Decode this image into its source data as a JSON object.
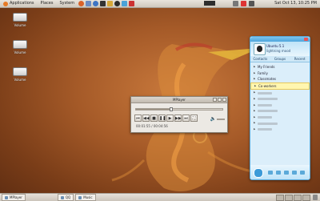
{
  "top_panel": {
    "menus": [
      "Applications",
      "Places",
      "System"
    ],
    "tray_input": "",
    "clock": "Sat Oct 13, 10:25 PM"
  },
  "desktop_icons": [
    {
      "label": "Volume"
    },
    {
      "label": "Volume"
    },
    {
      "label": "Volume"
    }
  ],
  "player": {
    "title": "MPlayer",
    "time": "00:01:55 / 00:04:56",
    "progress": 0.41
  },
  "qq": {
    "name": "Ubuntu 5.1",
    "status": "lightning mood",
    "tabs": [
      "Contacts",
      "Groups",
      "Recent"
    ],
    "groups": [
      {
        "label": "My Friends",
        "selected": false
      },
      {
        "label": "Family",
        "selected": false
      },
      {
        "label": "Classmates",
        "selected": false
      },
      {
        "label": "Co-workers",
        "selected": true
      },
      {
        "label": "",
        "selected": false
      },
      {
        "label": "",
        "selected": false
      },
      {
        "label": "",
        "selected": false
      },
      {
        "label": "",
        "selected": false
      },
      {
        "label": "",
        "selected": false
      },
      {
        "label": "",
        "selected": false
      },
      {
        "label": "",
        "selected": false
      }
    ]
  },
  "taskbar": {
    "tasks": [
      "MPlayer",
      "QQ",
      "Music"
    ]
  },
  "colors": {
    "desktop_center": "#c9793c",
    "desktop_edge": "#5e2d12",
    "qq_blue": "#4ea6dc",
    "selected_row": "#fff6b0"
  }
}
